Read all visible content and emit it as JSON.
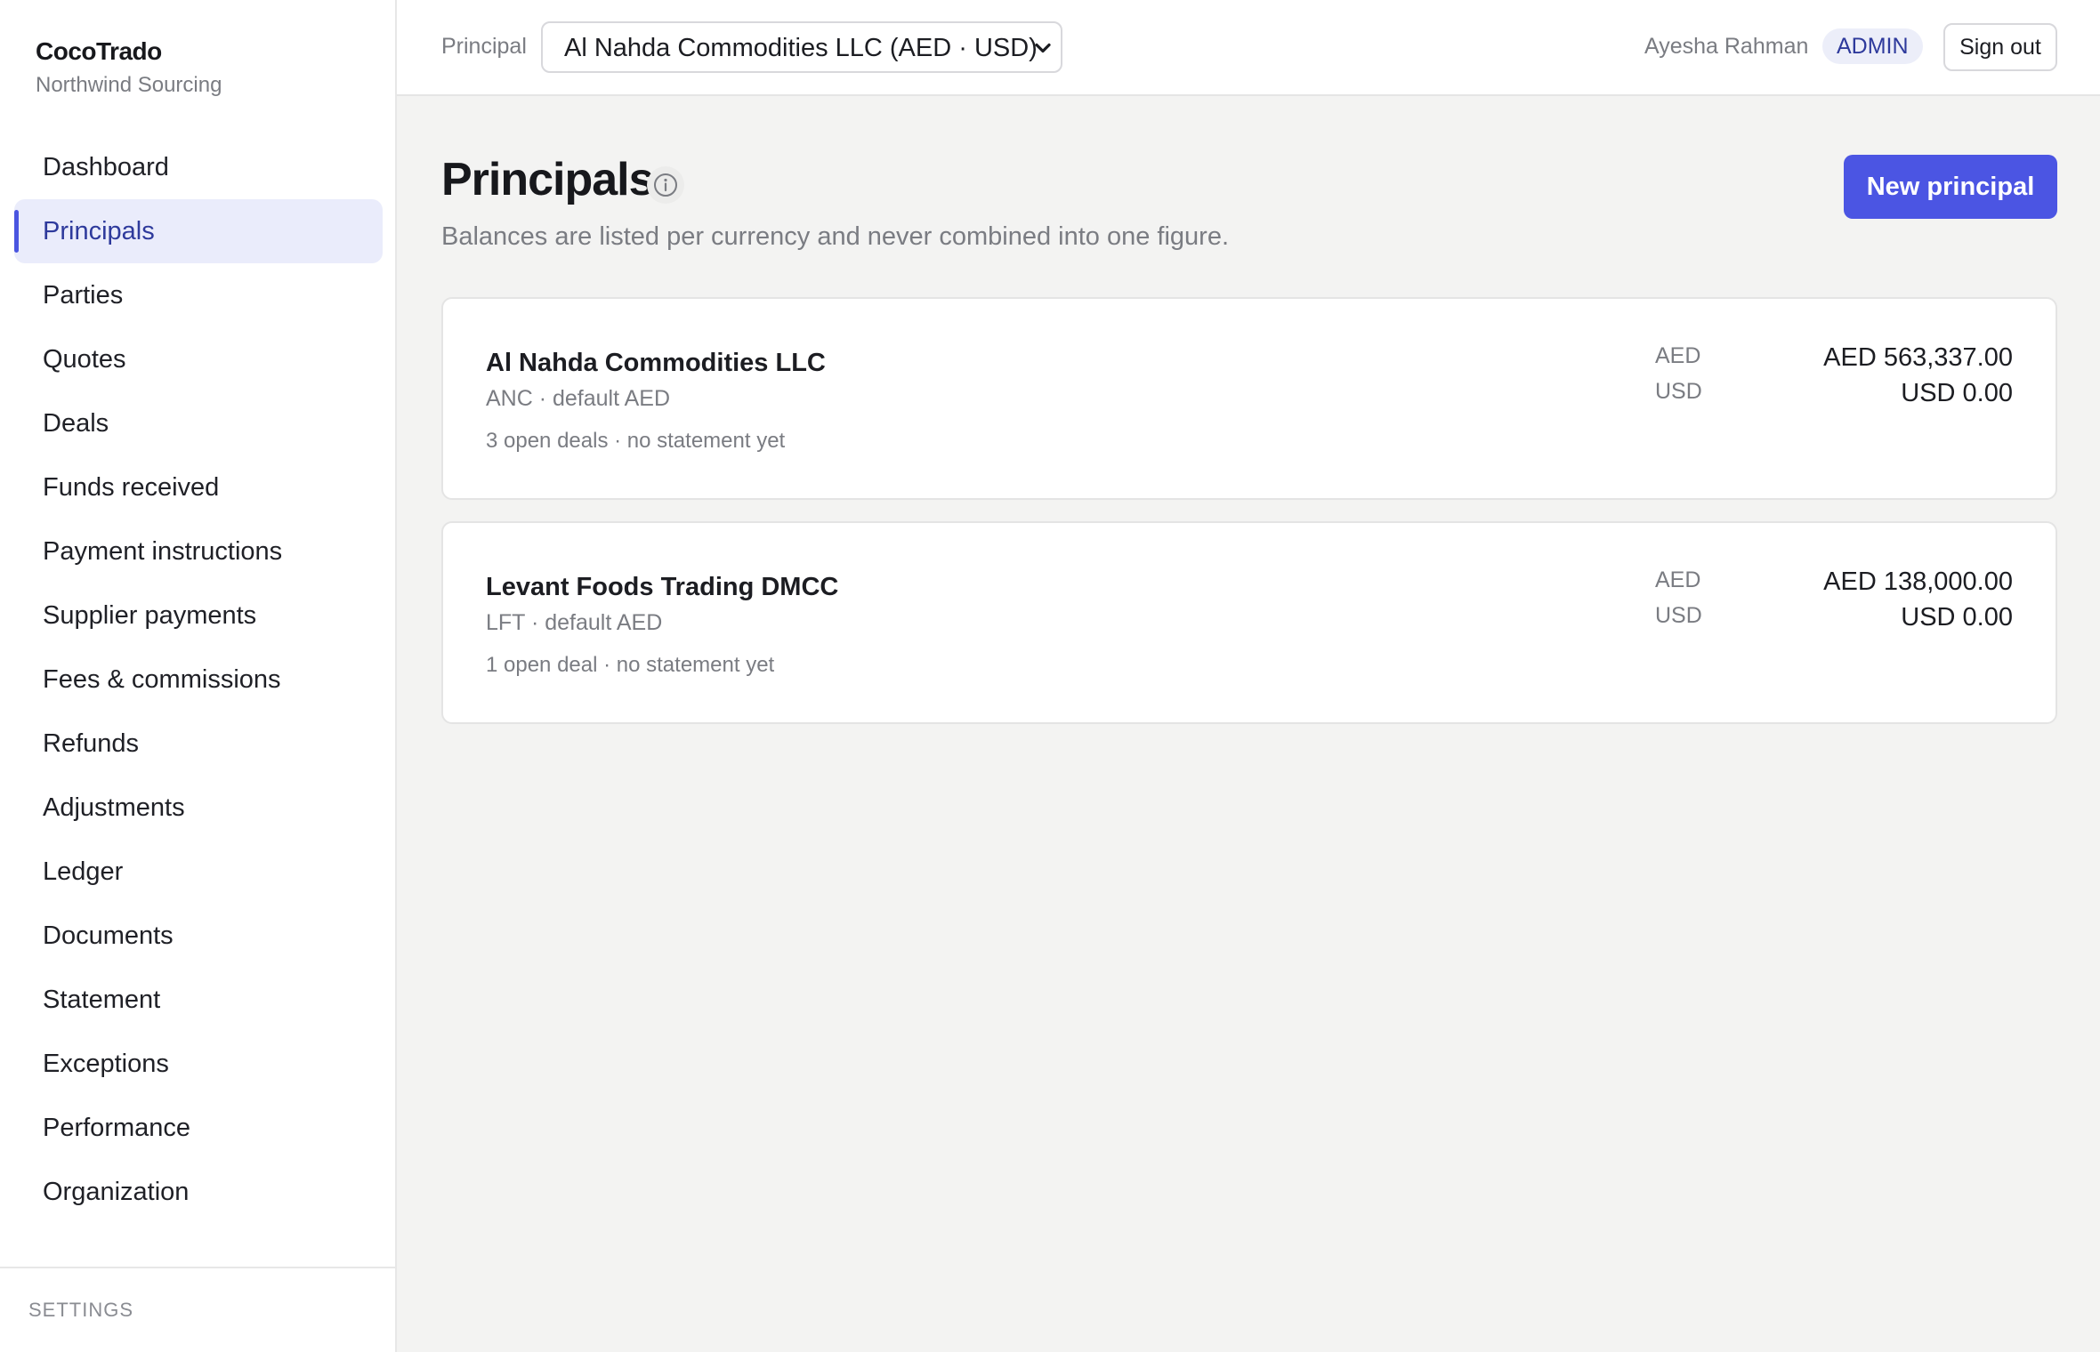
{
  "brand": {
    "name": "CocoTrado",
    "org": "Northwind Sourcing"
  },
  "sidebar": {
    "items": [
      {
        "label": "Dashboard"
      },
      {
        "label": "Principals",
        "active": true
      },
      {
        "label": "Parties"
      },
      {
        "label": "Quotes"
      },
      {
        "label": "Deals"
      },
      {
        "label": "Funds received"
      },
      {
        "label": "Payment instructions"
      },
      {
        "label": "Supplier payments"
      },
      {
        "label": "Fees & commissions"
      },
      {
        "label": "Refunds"
      },
      {
        "label": "Adjustments"
      },
      {
        "label": "Ledger"
      },
      {
        "label": "Documents"
      },
      {
        "label": "Statement"
      },
      {
        "label": "Exceptions"
      },
      {
        "label": "Performance"
      },
      {
        "label": "Organization"
      }
    ],
    "settings_label": "SETTINGS"
  },
  "topbar": {
    "principal_label": "Principal",
    "principal_selected": "Al Nahda Commodities LLC (AED · USD)",
    "user_name": "Ayesha Rahman",
    "role": "ADMIN",
    "signout_label": "Sign out"
  },
  "main": {
    "title": "Principals",
    "subtitle": "Balances are listed per currency and never combined into one figure.",
    "new_button": "New principal",
    "principals": [
      {
        "name": "Al Nahda Commodities LLC",
        "code_line": "ANC · default AED",
        "status_line": "3 open deals · no statement yet",
        "balances": [
          {
            "currency": "AED",
            "amount": "AED 563,337.00"
          },
          {
            "currency": "USD",
            "amount": "USD 0.00"
          }
        ]
      },
      {
        "name": "Levant Foods Trading DMCC",
        "code_line": "LFT · default AED",
        "status_line": "1 open deal · no statement yet",
        "balances": [
          {
            "currency": "AED",
            "amount": "AED 138,000.00"
          },
          {
            "currency": "USD",
            "amount": "USD 0.00"
          }
        ]
      }
    ]
  },
  "colors": {
    "accent": "#4b55e3",
    "active_nav_bg": "#eaecfb",
    "page_bg": "#f3f3f2"
  },
  "icons": {
    "info": "info-icon",
    "select_chevron": "chevron-down-icon"
  }
}
